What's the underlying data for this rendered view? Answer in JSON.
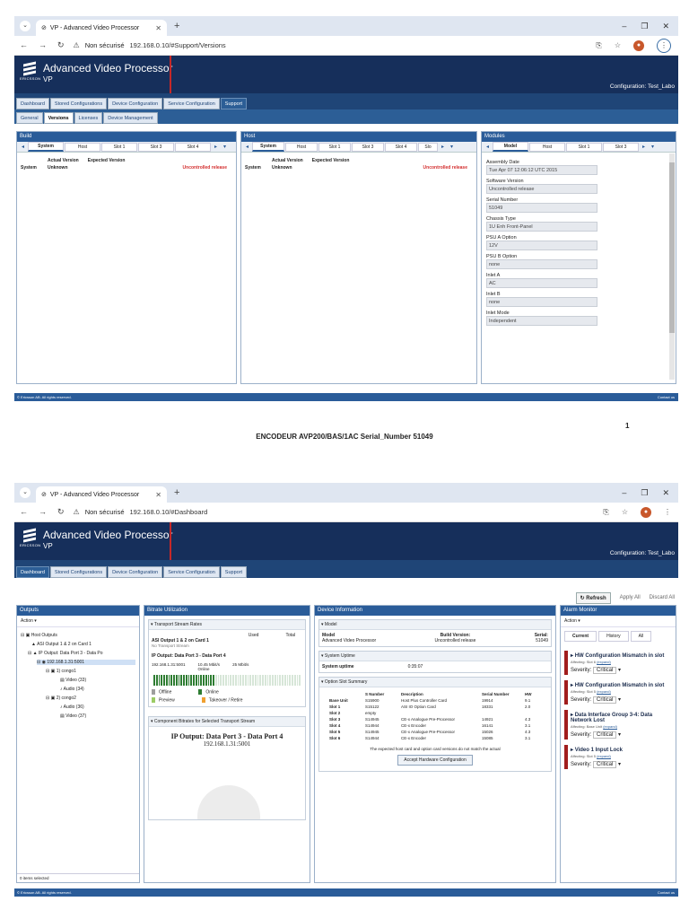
{
  "shot1": {
    "tab_title": "VP - Advanced Video Processor",
    "url_warning": "Non sécurisé",
    "url": "192.168.0.10/#Support/Versions",
    "app_title": "Advanced Video Processor",
    "app_subtitle": "VP",
    "logo_text": "ERICSSON",
    "configuration": "Configuration: Test_Labo",
    "nav_tabs": [
      "Dashboard",
      "Stored Configurations",
      "Device Configuration",
      "Service Configuration",
      "Support"
    ],
    "sub_tabs": [
      "General",
      "Versions",
      "Licenses",
      "Device Management"
    ],
    "build": {
      "title": "Build",
      "tabs": [
        "System",
        "Host",
        "Slot 1",
        "Slot 3",
        "Slot 4"
      ],
      "col_actual": "Actual Version",
      "col_expected": "Expected Version",
      "row_label": "System",
      "row_actual": "Unknown",
      "row_status": "Uncontrolled release"
    },
    "host": {
      "title": "Host",
      "tabs": [
        "System",
        "Host",
        "Slot 1",
        "Slot 3",
        "Slot 4",
        "Slo"
      ],
      "col_actual": "Actual Version",
      "col_expected": "Expected Version",
      "row_label": "System",
      "row_actual": "Unknown",
      "row_status": "Uncontrolled release"
    },
    "modules": {
      "title": "Modules",
      "tabs": [
        "Model",
        "Host",
        "Slot 1",
        "Slot 3"
      ],
      "fields": [
        {
          "label": "Assembly Date",
          "value": "Tue Apr 07 12:06:12 UTC 2015"
        },
        {
          "label": "Software Version",
          "value": "Uncontrolled release"
        },
        {
          "label": "Serial Number",
          "value": "51049"
        },
        {
          "label": "Chassis Type",
          "value": "1U Enh Front-Panel"
        },
        {
          "label": "PSU A Option",
          "value": "12V"
        },
        {
          "label": "PSU B Option",
          "value": "none"
        },
        {
          "label": "Inlet A",
          "value": "AC"
        },
        {
          "label": "Inlet B",
          "value": "none"
        },
        {
          "label": "Inlet Mode",
          "value": "Independent"
        }
      ]
    },
    "footer_left": "© Ericsson AB. All rights reserved.",
    "footer_right": "Contact us",
    "page_number": "1",
    "caption": "ENCODEUR AVP200/BAS/1AC  Serial_Number 51049"
  },
  "shot2": {
    "tab_title": "VP - Advanced Video Processor",
    "url_warning": "Non sécurisé",
    "url": "192.168.0.10/#Dashboard",
    "app_title": "Advanced Video Processor",
    "app_subtitle": "VP",
    "logo_text": "ERICSSON",
    "configuration": "Configuration: Test_Labo",
    "nav_tabs": [
      "Dashboard",
      "Stored Configurations",
      "Device Configuration",
      "Service Configuration",
      "Support"
    ],
    "toolbar": {
      "refresh": "Refresh",
      "apply": "Apply All",
      "discard": "Discard All"
    },
    "outputs": {
      "title": "Outputs",
      "action": "Action",
      "tree": [
        "Host Outputs",
        "ASI Output 1 & 2 on Card 1",
        "IP Output: Data Port 3 - Data Po",
        "192.168.1.31:5001",
        "1) congo1",
        "Video (33)",
        "Audio (34)",
        "2) congo2",
        "Audio (36)",
        "Video (37)"
      ],
      "status": "0 items selected"
    },
    "bitrate": {
      "title": "Bitrate Utilization",
      "section1": "Transport Stream Rates",
      "col_used": "Used",
      "col_total": "Total",
      "asi_title": "ASI Output 1 & 2 on Card 1",
      "asi_sub": "No Transport Stream",
      "ip_title": "IP Output: Data Port 3 - Data Port 4",
      "ip_addr": "192.168.1.31:5001",
      "ip_used": "10.45 Mbit/s",
      "ip_total": "25 Mbit/s",
      "ip_status": "Online",
      "legend": [
        "Offline",
        "Online",
        "Preview",
        "Takeover / Retire"
      ],
      "legend_colors": [
        "#9e9e9e",
        "#2e7d32",
        "#9ccc65",
        "#f0a030"
      ],
      "used_fraction": 0.42,
      "section2": "Component Bitrates for Selected Transport Stream",
      "comp_title": "IP Output: Data Port 3 - Data Port 4",
      "comp_addr": "192.168.1.31:5001"
    },
    "device": {
      "title": "Device Information",
      "model_section": "Model",
      "model_label": "Model",
      "model_value": "Advanced Video Processor",
      "build_label": "Build Version:",
      "build_value": "Uncontrolled release",
      "serial_label": "Serial:",
      "serial_value": "51049",
      "uptime_section": "System Uptime",
      "uptime_label": "System uptime",
      "uptime_value": "0:35:07",
      "slot_section": "Option Slot Summary",
      "slot_headers": [
        "",
        "S Number",
        "Description",
        "Serial Number",
        "HW"
      ],
      "slots": [
        [
          "Base Unit",
          "S15900",
          "Host Plus Controller Card",
          "19914",
          "9.1"
        ],
        [
          "Slot 1",
          "S15122",
          "ASI IO Option Card",
          "18331",
          "2.0"
        ],
        [
          "Slot 2",
          "empty",
          "",
          "",
          ""
        ],
        [
          "Slot 3",
          "S14945",
          "CE-x Analogue Pre-Processor",
          "14921",
          "4.3"
        ],
        [
          "Slot 4",
          "S14944",
          "CE-x Encoder",
          "16141",
          "3.1"
        ],
        [
          "Slot 5",
          "S14945",
          "CE-x Analogue Pre-Processor",
          "15026",
          "4.3"
        ],
        [
          "Slot 6",
          "S14944",
          "CE-x Encoder",
          "15085",
          "3.1"
        ]
      ],
      "mismatch_note": "The expected host card and option card versions do not match the actual",
      "accept_button": "Accept Hardware Configuration"
    },
    "alarm": {
      "title": "Alarm Monitor",
      "action": "Action",
      "tabs": [
        "Current",
        "History",
        "All"
      ],
      "severity_label": "Severity:",
      "items": [
        {
          "title": "HW Configuration Mismatch in slot",
          "affecting": "Affecting: Slot 6",
          "link": "(expand)",
          "severity": "Critical"
        },
        {
          "title": "HW Configuration Mismatch in slot",
          "affecting": "Affecting: Slot 5",
          "link": "(expand)",
          "severity": "Critical"
        },
        {
          "title": "Data Interface Group 3-4: Data Network Lost",
          "affecting": "Affecting: Base Unit",
          "link": "(expand)",
          "severity": "Critical"
        },
        {
          "title": "Video 1 Input Lock",
          "affecting": "Affecting: Slot 5",
          "link": "(expand)",
          "severity": "Critical"
        }
      ]
    },
    "footer_left": "© Ericsson AB. All rights reserved.",
    "footer_right": "Contact us"
  }
}
